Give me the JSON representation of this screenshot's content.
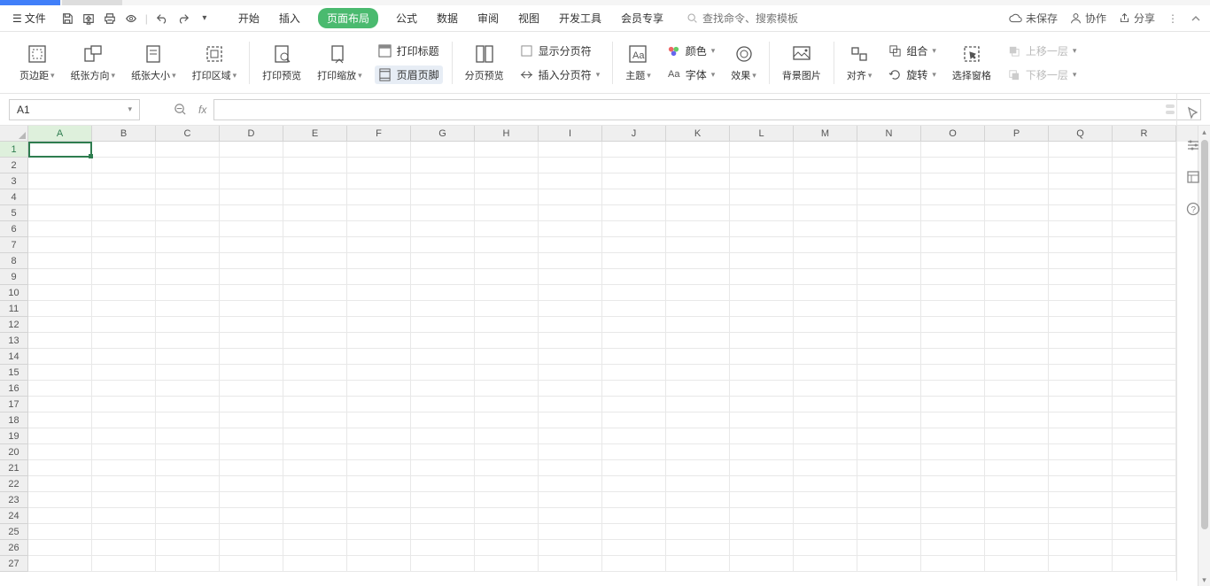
{
  "menubar": {
    "file": "文件",
    "tabs": [
      "开始",
      "插入",
      "页面布局",
      "公式",
      "数据",
      "审阅",
      "视图",
      "开发工具",
      "会员专享"
    ],
    "active_tab_index": 2,
    "search_placeholder": "查找命令、搜索模板",
    "right": {
      "unsaved": "未保存",
      "collab": "协作",
      "share": "分享"
    }
  },
  "ribbon": {
    "margins": "页边距",
    "orientation": "纸张方向",
    "size": "纸张大小",
    "print_area": "打印区域",
    "print_preview": "打印预览",
    "print_zoom": "打印缩放",
    "print_titles": "打印标题",
    "header_footer": "页眉页脚",
    "page_break_preview": "分页预览",
    "show_page_breaks": "显示分页符",
    "insert_page_break": "插入分页符",
    "themes": "主题",
    "colors": "颜色",
    "fonts": "字体",
    "effects": "效果",
    "background": "背景图片",
    "align": "对齐",
    "group": "组合",
    "rotate": "旋转",
    "selection_pane": "选择窗格",
    "bring_forward": "上移一层",
    "send_backward": "下移一层"
  },
  "formula": {
    "name_box": "A1"
  },
  "columns": [
    "A",
    "B",
    "C",
    "D",
    "E",
    "F",
    "G",
    "H",
    "I",
    "J",
    "K",
    "L",
    "M",
    "N",
    "O",
    "P",
    "Q",
    "R"
  ],
  "rows": [
    1,
    2,
    3,
    4,
    5,
    6,
    7,
    8,
    9,
    10,
    11,
    12,
    13,
    14,
    15,
    16,
    17,
    18,
    19,
    20,
    21,
    22,
    23,
    24,
    25,
    26,
    27
  ],
  "selection": {
    "col": 0,
    "row": 0
  }
}
